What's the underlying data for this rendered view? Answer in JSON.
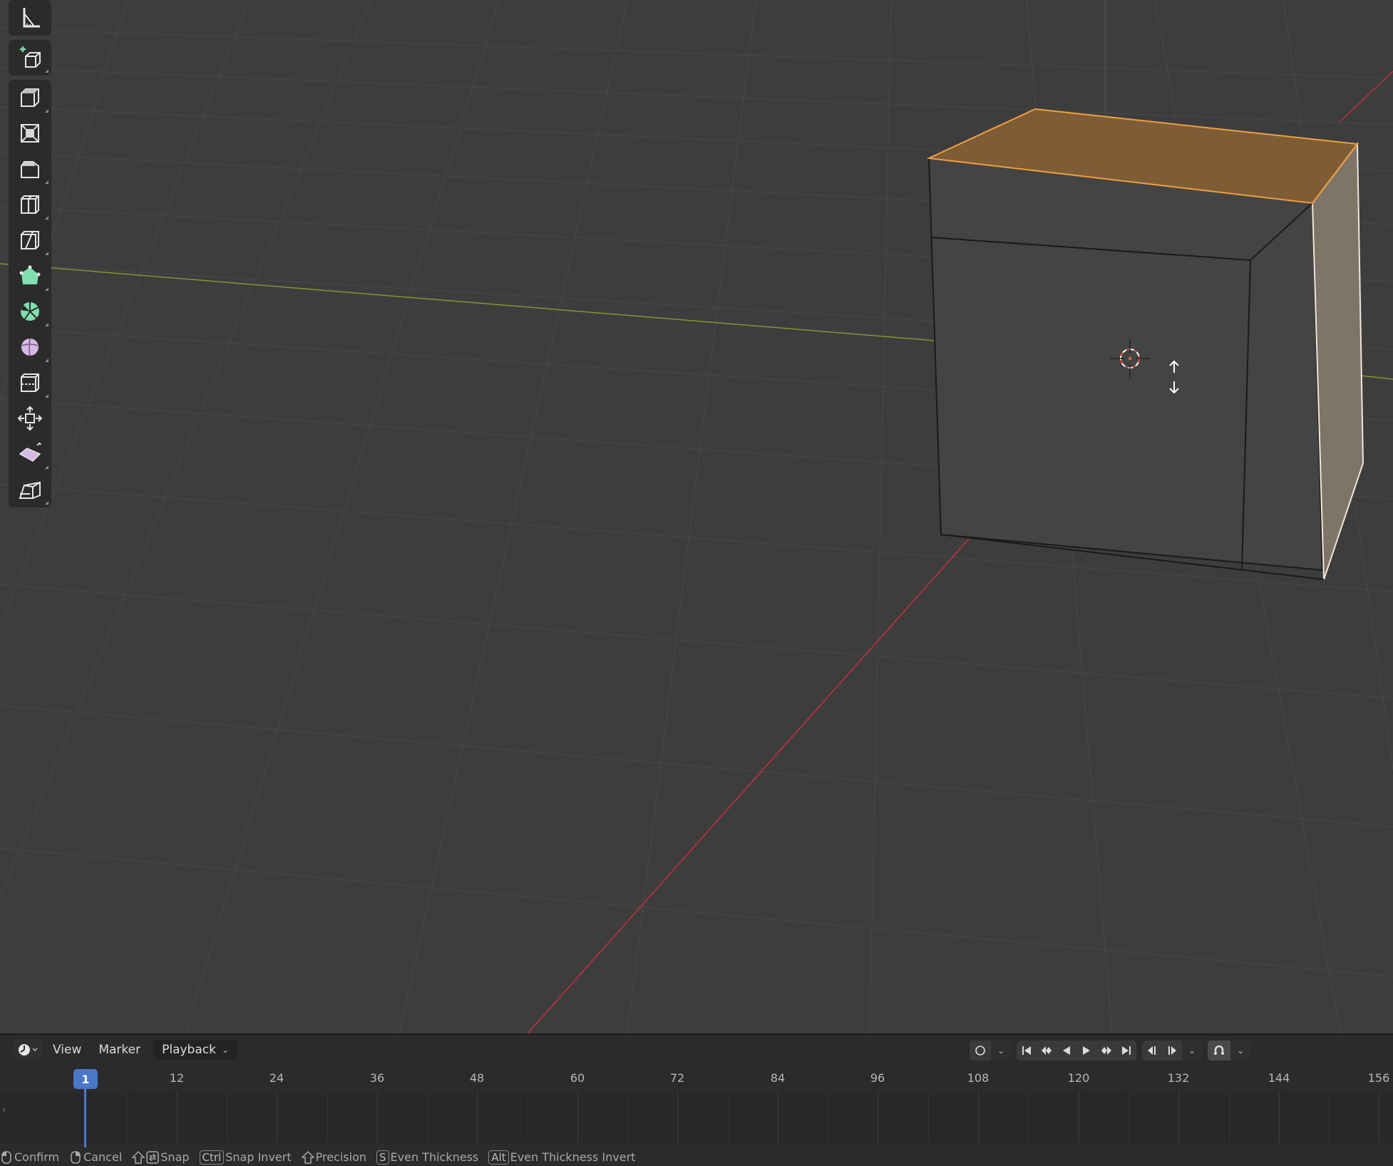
{
  "toolbar": {
    "tools": [
      {
        "icon": "measure-icon"
      },
      {
        "icon": "add-cube-icon"
      },
      {
        "icon": "extrude-region-icon"
      },
      {
        "icon": "inset-faces-icon"
      },
      {
        "icon": "bevel-icon"
      },
      {
        "icon": "loop-cut-icon"
      },
      {
        "icon": "knife-icon"
      },
      {
        "icon": "poly-build-icon"
      },
      {
        "icon": "spin-icon"
      },
      {
        "icon": "smooth-icon"
      },
      {
        "icon": "edge-slide-icon"
      },
      {
        "icon": "shrink-fatten-icon"
      },
      {
        "icon": "shear-icon"
      },
      {
        "icon": "rip-region-icon"
      }
    ]
  },
  "timeline": {
    "menus": {
      "view": "View",
      "marker": "Marker",
      "playback": "Playback"
    },
    "current_frame": "1",
    "ticks": [
      "12",
      "24",
      "36",
      "48",
      "60",
      "72",
      "84",
      "96",
      "108",
      "120",
      "132",
      "144",
      "156"
    ]
  },
  "statusbar": {
    "confirm": "Confirm",
    "cancel": "Cancel",
    "snap": "Snap",
    "ctrl_key": "Ctrl",
    "snap_invert": "Snap Invert",
    "precision": "Precision",
    "s_key": "S",
    "even_thickness": "Even Thickness",
    "alt_key": "Alt",
    "even_thickness_invert": "Even Thickness Invert"
  },
  "colors": {
    "selected_face": "#8a6436",
    "selected_edge": "#f0a040",
    "x_axis": "#c03040",
    "y_axis": "#7a9a30",
    "frame_cursor": "#4a78c8"
  }
}
